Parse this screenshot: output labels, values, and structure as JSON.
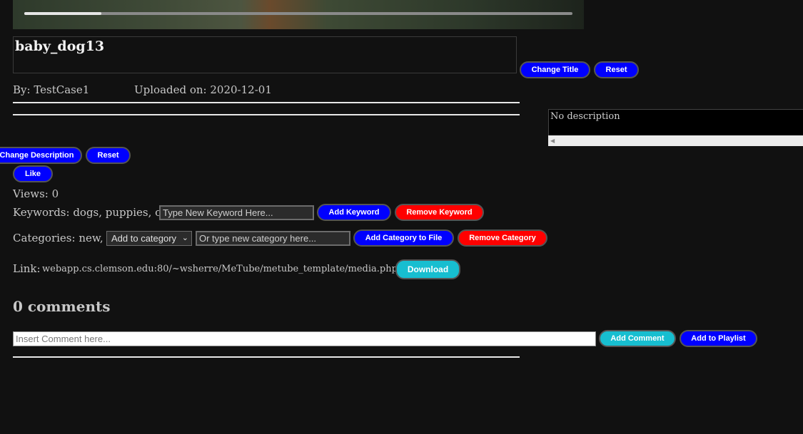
{
  "video": {
    "progress": 0.14
  },
  "media": {
    "title": "baby_dog13",
    "by": "By: TestCase1",
    "uploaded": "Uploaded on: 2020-12-01",
    "description": "No description",
    "views": "Views: 0",
    "keywords": "Keywords: dogs, puppies, cute,",
    "categories": "Categories: new,",
    "link_label": "Link:",
    "link_url": "webapp.cs.clemson.edu:80/~wsherre/MeTube/metube_template/media.php?id=35",
    "comments_heading": "0 comments"
  },
  "buttons": {
    "change_title": "Change Title",
    "reset_title": "Reset",
    "change_description": "Change Description",
    "reset_description": "Reset",
    "like": "Like",
    "add_keyword": "Add Keyword",
    "remove_keyword": "Remove Keyword",
    "add_category": "Add Category to File",
    "remove_category": "Remove Category",
    "download": "Download",
    "add_comment": "Add Comment",
    "add_playlist": "Add to Playlist"
  },
  "inputs": {
    "keyword_placeholder": "Type New Keyword Here...",
    "category_placeholder": "Or type new category here...",
    "category_select": "Add to category",
    "comment_placeholder": "Insert Comment here..."
  },
  "colors": {
    "primary_button": "#0000ff",
    "danger_button": "#ff0000",
    "accent_button": "#17bed0",
    "background": "#111111"
  }
}
